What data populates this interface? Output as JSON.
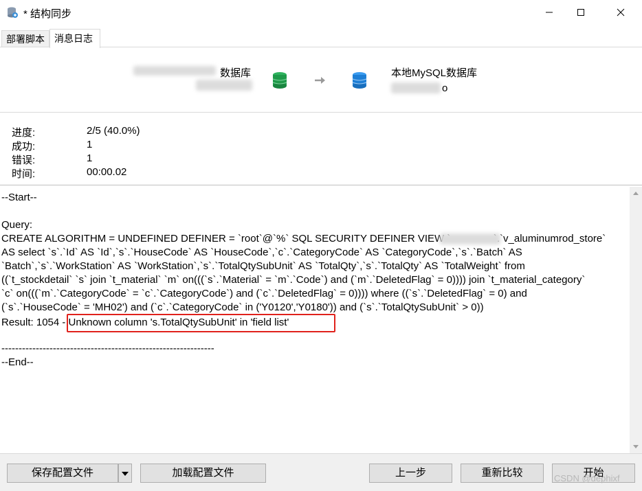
{
  "window": {
    "title": "* 结构同步"
  },
  "tabs": [
    {
      "label": "部署脚本"
    },
    {
      "label": "消息日志"
    }
  ],
  "databases": {
    "source_label": "数据库",
    "target_label": "本地MySQL数据库",
    "target_name": "o"
  },
  "progress": {
    "labels": [
      "进度:",
      "成功:",
      "错误:",
      "时间:"
    ],
    "values": [
      "2/5 (40.0%)",
      "1",
      "1",
      "00:00.02"
    ]
  },
  "log": {
    "lines": [
      "--Start--",
      "",
      "Query:",
      "CREATE ALGORITHM = UNDEFINED DEFINER = `root`@`%` SQL SECURITY DEFINER VIEW `               `.`v_aluminumrod_store`",
      "AS select `s`.`Id` AS `Id`,`s`.`HouseCode` AS `HouseCode`,`c`.`CategoryCode` AS `CategoryCode`,`s`.`Batch` AS",
      "`Batch`,`s`.`WorkStation` AS `WorkStation`,`s`.`TotalQtySubUnit` AS `TotalQty`,`s`.`TotalQty` AS `TotalWeight` from",
      "((`t_stockdetail` `s` join `t_material` `m` on(((`s`.`Material` = `m`.`Code`) and (`m`.`DeletedFlag` = 0)))) join `t_material_category`",
      "`c` on(((`m`.`CategoryCode` = `c`.`CategoryCode`) and (`c`.`DeletedFlag` = 0)))) where ((`s`.`DeletedFlag` = 0) and",
      "(`s`.`HouseCode` = 'MH02') and (`c`.`CategoryCode` in ('Y0120','Y0180')) and (`s`.`TotalQtySubUnit` > 0))",
      "Result: 1054 - Unknown column 's.TotalQtySubUnit' in 'field list'",
      "",
      "--------------------------------------------------------------",
      "--End--"
    ]
  },
  "buttons": {
    "save_config": "保存配置文件",
    "load_config": "加载配置文件",
    "prev": "上一步",
    "compare": "重新比较",
    "start": "开始"
  },
  "watermark": "CSDN @dephixf",
  "colors": {
    "error_highlight": "#e0211b",
    "source_db": "#1f9a4a",
    "target_db": "#1e7fd6"
  }
}
